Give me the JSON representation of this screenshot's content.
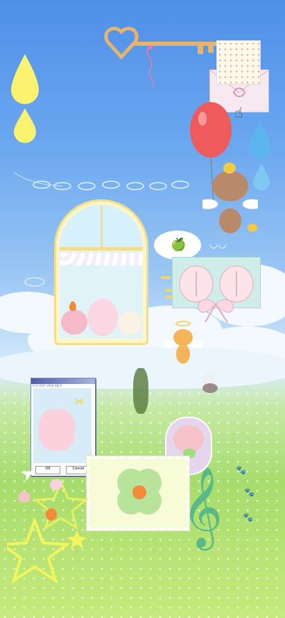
{
  "screen": {
    "name": "home-screen-wallpaper",
    "theme": "pastel kawaii sky and meadow"
  },
  "colors": {
    "sky_top": "#4e8fe8",
    "sky_mid": "#9cc8f4",
    "meadow": "#a6dc6c",
    "balloon": "#ef5a5a",
    "key_gold": "#e8b46a",
    "drop_yellow": "#fbf36e",
    "drop_blue": "#5bb6ef",
    "bear_brown": "#b98a6a",
    "clover_green": "#8fd072",
    "music_green": "#58b887"
  },
  "widgets": {
    "mini_window": {
      "title": "Ecoute Flecombos",
      "menu": "FILE  EDIT  VIEW  HELP",
      "button_left": "OK",
      "button_right": "Cancel"
    }
  },
  "icons": [
    "key-icon",
    "envelope-icon",
    "hand-cursor-icon",
    "balloon-icon",
    "bear-icon",
    "chick-icon",
    "apple-icon",
    "bunny-icon",
    "clover-icon",
    "carrot-icon",
    "star-icon",
    "music-note-icon",
    "pawprint-icon"
  ]
}
